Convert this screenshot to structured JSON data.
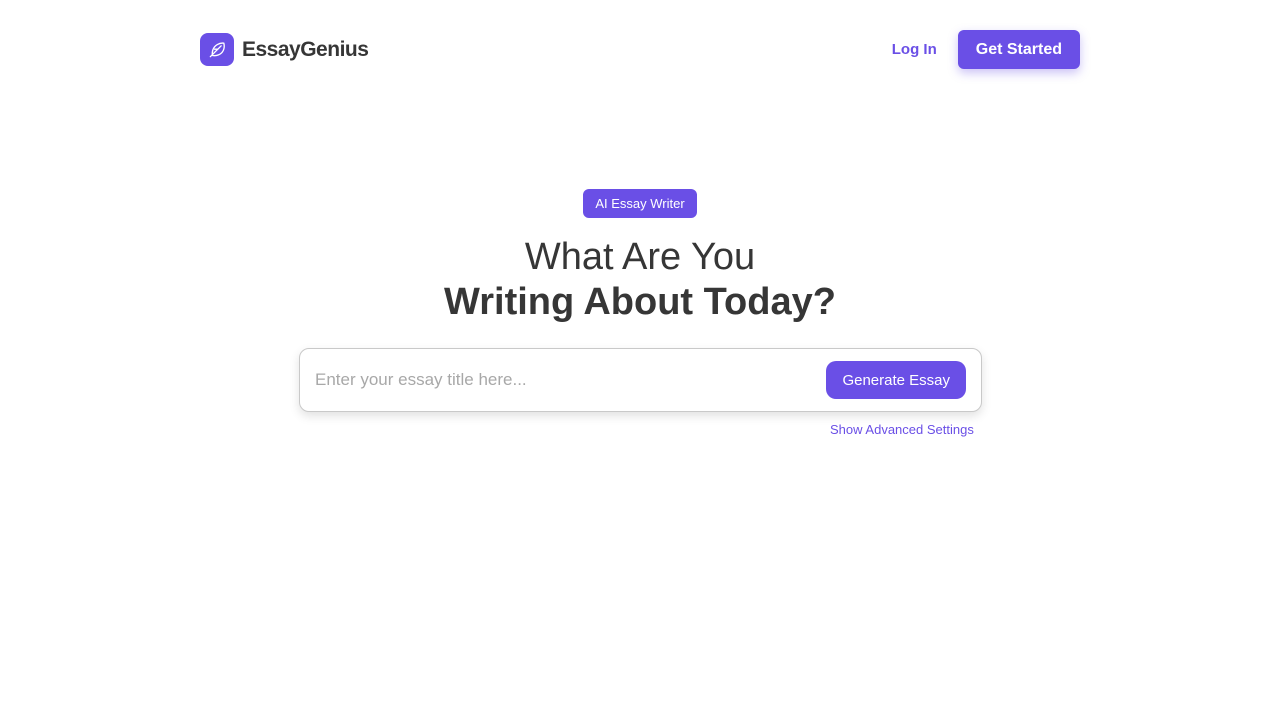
{
  "header": {
    "brand_name": "EssayGenius",
    "brand_icon": "feather-icon",
    "login_label": "Log In",
    "cta_label": "Get Started"
  },
  "hero": {
    "badge": "AI Essay Writer",
    "title_line1": "What Are You",
    "title_line2": "Writing About Today?"
  },
  "search": {
    "placeholder": "Enter your essay title here...",
    "value": "",
    "button_label": "Generate Essay",
    "advanced_label": "Show Advanced Settings"
  },
  "colors": {
    "accent": "#6a4fe6",
    "text": "#363636",
    "placeholder": "#a8a8a8",
    "background": "#ffffff"
  }
}
